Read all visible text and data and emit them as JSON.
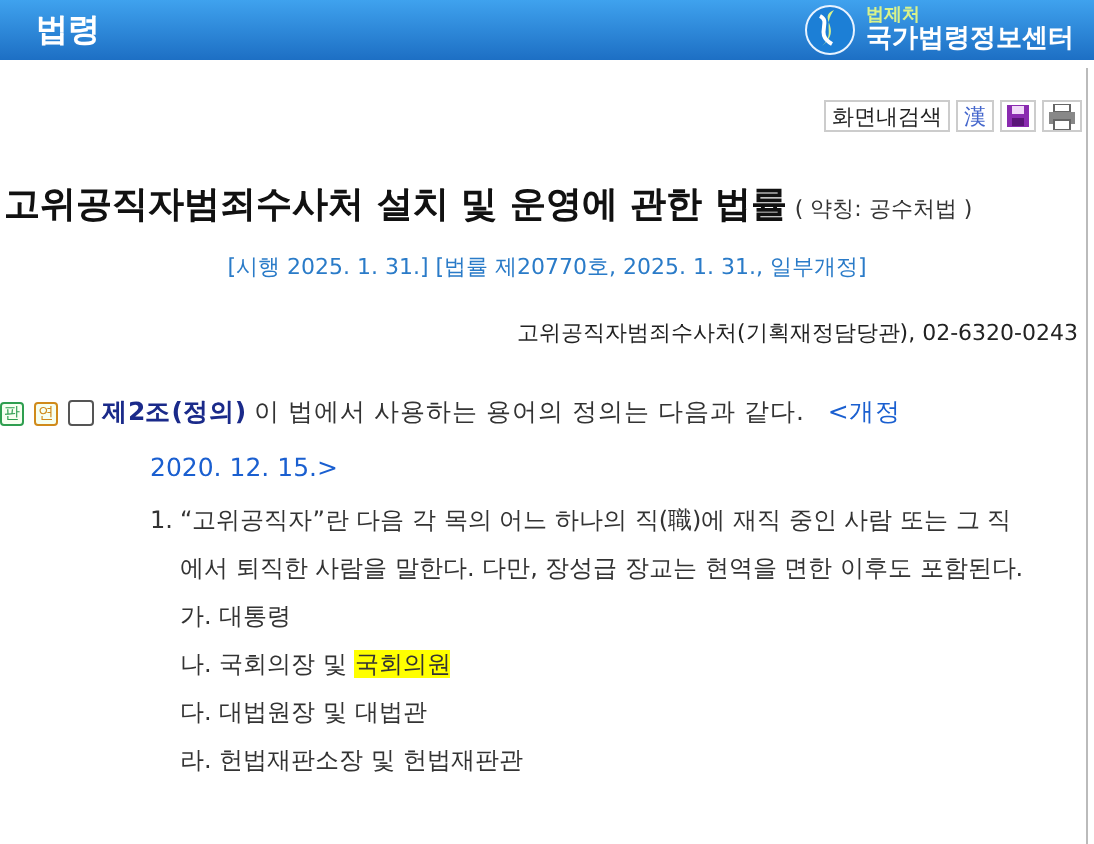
{
  "header": {
    "title": "법령",
    "agency": "법제처",
    "site": "국가법령정보센터"
  },
  "toolbar": {
    "search_button": "화면내검색",
    "hanja_button": "漢"
  },
  "law": {
    "title": "고위공직자범죄수사처 설치 및 운영에 관한 법률",
    "abbreviation": "( 약칭: 공수처법 )",
    "enforcement": "[시행 2025. 1. 31.] [법률 제20770호, 2025. 1. 31., 일부개정]",
    "contact": "고위공직자범죄수사처(기획재정담당관), 02-6320-0243"
  },
  "article": {
    "badges": [
      {
        "label": "판",
        "color": "#2e9e4f"
      },
      {
        "label": "연",
        "color": "#d08a1a"
      }
    ],
    "checked": false,
    "heading": "제2조(정의)",
    "text": "이 법에서 사용하는 용어의 정의는 다음과 같다.",
    "amendment": "<개정 2020. 12. 15.>",
    "clauses": [
      {
        "number": "1.",
        "text": "“고위공직자”란 다음 각 목의 어느 하나의 직(職)에 재직 중인 사람 또는 그 직에서 퇴직한 사람을 말한다. 다만, 장성급 장교는 현역을 면한 이후도 포함된다.",
        "items": [
          {
            "text": "가. 대통령"
          },
          {
            "text": "나. 국회의장 및 ",
            "highlight": "국회의원"
          },
          {
            "text": "다. 대법원장 및 대법관"
          },
          {
            "text": "라. 헌법재판소장 및 헌법재판관"
          }
        ]
      }
    ]
  }
}
